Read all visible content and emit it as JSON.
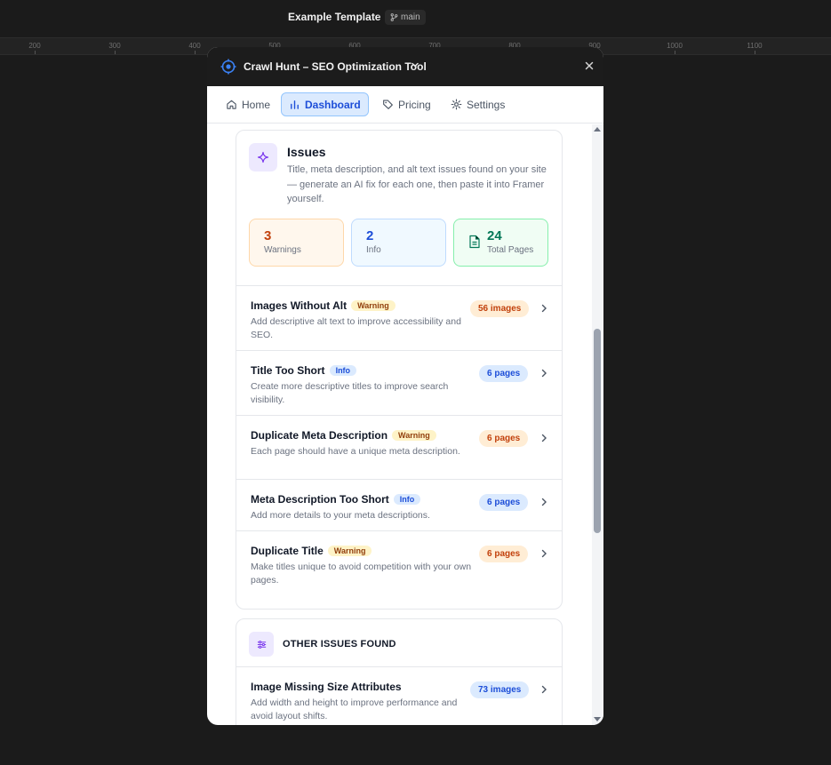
{
  "topbar": {
    "project_title": "Example Template",
    "separator": "·",
    "branch": "main"
  },
  "ruler": {
    "ticks": [
      "200",
      "300",
      "400",
      "500",
      "600",
      "700",
      "800",
      "900",
      "1000",
      "1100"
    ]
  },
  "plugin": {
    "title": "Crawl Hunt – SEO Optimization Tool"
  },
  "nav": {
    "tabs": [
      {
        "label": "Home",
        "icon": "home-icon"
      },
      {
        "label": "Dashboard",
        "icon": "bar-chart-icon",
        "active": true
      },
      {
        "label": "Pricing",
        "icon": "tag-icon"
      },
      {
        "label": "Settings",
        "icon": "gear-icon"
      }
    ]
  },
  "issues": {
    "title": "Issues",
    "description": "Title, meta description, and alt text issues found on your site — generate an AI fix for each one, then paste it into Framer yourself.",
    "stats": {
      "warnings": {
        "value": "3",
        "label": "Warnings"
      },
      "info": {
        "value": "2",
        "label": "Info"
      },
      "pages": {
        "value": "24",
        "label": "Total Pages"
      }
    },
    "rows": [
      {
        "title": "Images Without Alt",
        "badge": "Warning",
        "desc": "Add descriptive alt text to improve accessibility and SEO.",
        "count": "56 images"
      },
      {
        "title": "Title Too Short",
        "badge": "Info",
        "desc": "Create more descriptive titles to improve search visibility.",
        "count": "6 pages"
      },
      {
        "title": "Duplicate Meta Description",
        "badge": "Warning",
        "desc": "Each page should have a unique meta description.",
        "count": "6 pages"
      },
      {
        "title": "Meta Description Too Short",
        "badge": "Info",
        "desc": "Add more details to your meta descriptions.",
        "count": "6 pages"
      },
      {
        "title": "Duplicate Title",
        "badge": "Warning",
        "desc": "Make titles unique to avoid competition with your own pages.",
        "count": "6 pages"
      }
    ]
  },
  "other": {
    "title": "OTHER ISSUES FOUND",
    "rows": [
      {
        "title": "Image Missing Size Attributes",
        "desc": "Add width and height to improve performance and avoid layout shifts.",
        "count": "73 images"
      }
    ]
  },
  "colors": {
    "accent": "#1d4ed8",
    "warning": "#c2410c",
    "success": "#047857",
    "purple": "#7c3aed"
  }
}
